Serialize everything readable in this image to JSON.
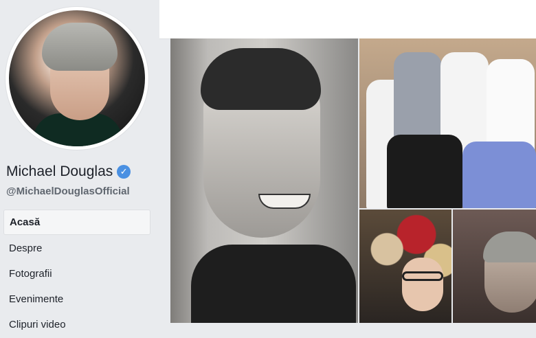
{
  "profile": {
    "name": "Michael Douglas",
    "handle": "@MichaelDouglasOfficial",
    "verified_glyph": "✓"
  },
  "nav": {
    "items": [
      {
        "label": "Acasă",
        "active": true
      },
      {
        "label": "Despre",
        "active": false
      },
      {
        "label": "Fotografii",
        "active": false
      },
      {
        "label": "Evenimente",
        "active": false
      },
      {
        "label": "Clipuri video",
        "active": false
      }
    ]
  },
  "colors": {
    "verified_badge": "#4a90e2",
    "sidebar_bg": "#e9ebee"
  }
}
